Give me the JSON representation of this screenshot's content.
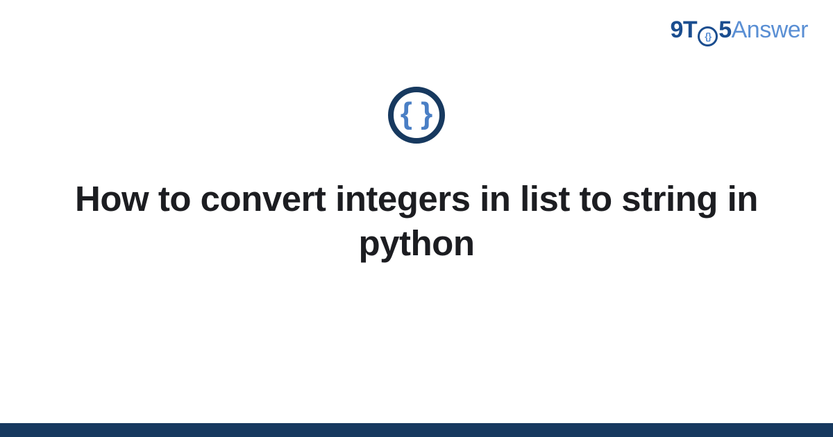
{
  "logo": {
    "part1": "9T",
    "circle_inner": "{}",
    "part2": "5",
    "part3": "Answer"
  },
  "badge": {
    "glyph": "{ }"
  },
  "title": "How to convert integers in list to string in python"
}
